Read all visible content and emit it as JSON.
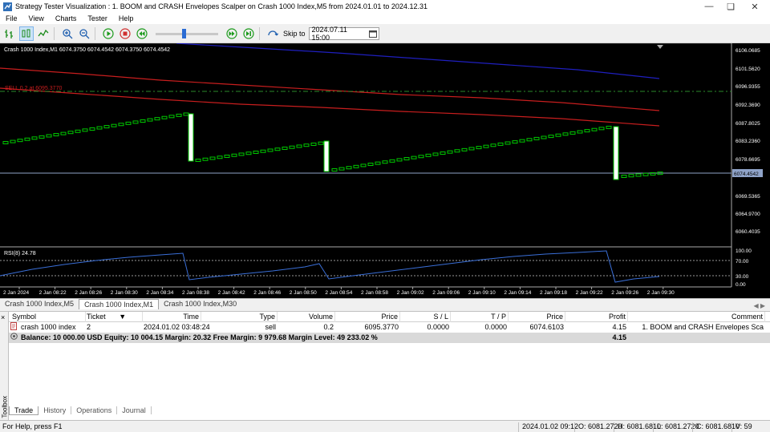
{
  "window": {
    "title": "Strategy Tester Visualization : 1. BOOM and CRASH Envelopes Scalper on Crash 1000 Index,M5 from 2024.01.01 to 2024.12.31"
  },
  "menu": [
    "File",
    "View",
    "Charts",
    "Tester",
    "Help"
  ],
  "toolbar": {
    "skip_label": "Skip to",
    "skip_date": "2024.07.11 15:00"
  },
  "chart": {
    "header": "Crash 1000 Index,M1  6074.3750 6074.4542 6074.3750 6074.4542",
    "order_label": "SELL 0.2 at 6095.3770",
    "price_labels": [
      "6106.0685",
      "6101.5620",
      "6096.9355",
      "6092.3690",
      "6087.8025",
      "6083.2360",
      "6078.6695",
      "6074.4542",
      "6069.5365",
      "6064.9700",
      "6060.4035"
    ],
    "rsi_label": "RSI(8) 24.78",
    "rsi_labels": [
      "100.00",
      "70.00",
      "30.00",
      "0.00"
    ],
    "time_labels": [
      "2 Jan 2024",
      "2 Jan 08:22",
      "2 Jan 08:26",
      "2 Jan 08:30",
      "2 Jan 08:34",
      "2 Jan 08:38",
      "2 Jan 08:42",
      "2 Jan 08:46",
      "2 Jan 08:50",
      "2 Jan 08:54",
      "2 Jan 08:58",
      "2 Jan 09:02",
      "2 Jan 09:06",
      "2 Jan 09:10",
      "2 Jan 09:14",
      "2 Jan 09:18",
      "2 Jan 09:22",
      "2 Jan 09:26",
      "2 Jan 09:30"
    ],
    "colors": {
      "blue_line": "#1f1fbf",
      "red_line": "#c81e1e",
      "candle": "#00c800",
      "rsi": "#3a6fd8",
      "current": "#8fa3c8"
    }
  },
  "chart_tabs": [
    "Crash 1000 Index,M5",
    "Crash 1000 Index,M1",
    "Crash 1000 Index,M30"
  ],
  "chart_tabs_selected": 1,
  "trade_table": {
    "headers": [
      "Symbol",
      "Ticket",
      "Time",
      "Type",
      "Volume",
      "Price",
      "S / L",
      "T / P",
      "Price",
      "Profit",
      "Comment"
    ],
    "rows": [
      [
        "crash 1000 index",
        "2",
        "2024.01.02 03:48:24",
        "sell",
        "0.2",
        "6095.3770",
        "0.0000",
        "0.0000",
        "6074.6103",
        "4.15",
        "1. BOOM and CRASH Envelopes Sca"
      ]
    ],
    "balance_text": "Balance: 10 000.00 USD  Equity: 10 004.15  Margin: 20.32  Free Margin: 9 979.68  Margin Level: 49 233.02 %",
    "balance_profit": "4.15"
  },
  "toolbox_label": "Toolbox",
  "bottom_tabs": [
    "Trade",
    "History",
    "Operations",
    "Journal"
  ],
  "status": {
    "help": "For Help, press F1",
    "datetime": "2024.01.02 09:12",
    "open": "O: 6081.2720",
    "high": "H: 6081.6810",
    "low": "L: 6081.2720",
    "close": "C: 6081.6810",
    "volume": "V: 59"
  }
}
